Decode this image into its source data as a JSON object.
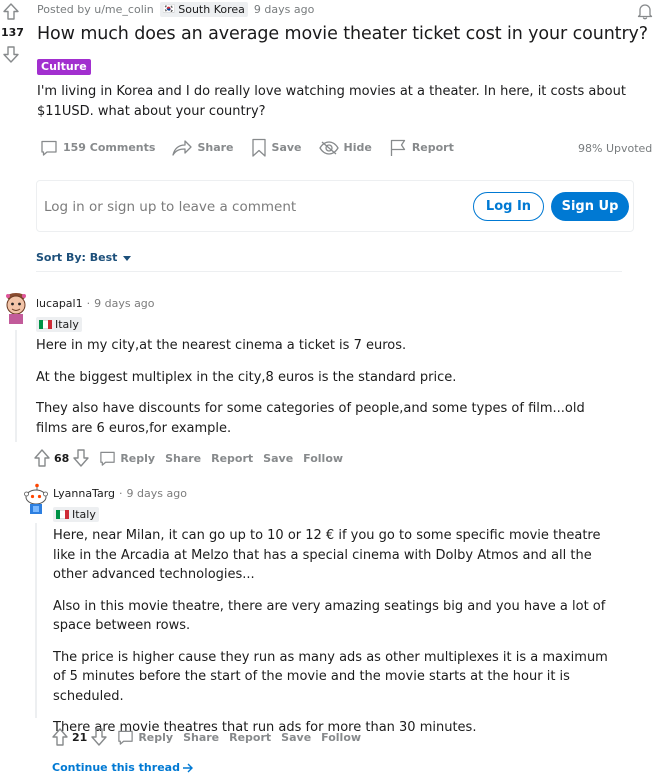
{
  "post": {
    "score": "137",
    "posted_by": "Posted by u/me_colin",
    "location_flag": "🇰🇷",
    "location": "South Korea",
    "time": "9 days ago",
    "title": "How much does an average movie theater ticket cost in your country?",
    "flair": "Culture",
    "body": "I'm living in Korea and I do really love watching movies at a theater. In here, it costs about $11USD. what about your country?",
    "actions": {
      "comments": "159 Comments",
      "share": "Share",
      "save": "Save",
      "hide": "Hide",
      "report": "Report"
    },
    "upvoted": "98% Upvoted"
  },
  "comment_box": {
    "prompt": "Log in or sign up to leave a comment",
    "login": "Log In",
    "signup": "Sign Up"
  },
  "sort": {
    "label": "Sort By: Best"
  },
  "comments": [
    {
      "user": "lucapal1",
      "time": "9 days ago",
      "flair": "Italy",
      "paragraphs": [
        "Here in my city,at the nearest cinema a ticket is 7 euros.",
        "At the biggest multiplex in the city,8 euros is the standard price.",
        "They also have discounts for some categories of people,and some types of film...old films are 6 euros,for example."
      ],
      "score": "68",
      "actions": {
        "reply": "Reply",
        "share": "Share",
        "report": "Report",
        "save": "Save",
        "follow": "Follow"
      }
    },
    {
      "user": "LyannaTarg",
      "time": "9 days ago",
      "flair": "Italy",
      "paragraphs": [
        "Here, near Milan, it can go up to 10 or 12 € if you go to some specific movie theatre like in the Arcadia at Melzo that has a special cinema with Dolby Atmos and all the other advanced technologies...",
        "Also in this movie theatre, there are very amazing seatings big and you have a lot of space between rows.",
        "The price is higher cause they run as many ads as other multiplexes it is a maximum of 5 minutes before the start of the movie and the movie starts at the hour it is scheduled.",
        "There are movie theatres that run ads for more than 30 minutes."
      ],
      "score": "21",
      "actions": {
        "reply": "Reply",
        "share": "Share",
        "report": "Report",
        "save": "Save",
        "follow": "Follow"
      }
    }
  ],
  "continue_thread": "Continue this thread",
  "colors": {
    "accent": "#0079d3",
    "flair": "#a22fcf",
    "muted": "#878a8c"
  },
  "icons": [
    "upvote-arrow-icon",
    "downvote-arrow-icon",
    "comment-icon",
    "share-icon",
    "save-bookmark-icon",
    "hide-eye-icon",
    "report-flag-icon",
    "chevron-down-icon",
    "notification-bell-icon",
    "arrow-right-icon"
  ]
}
